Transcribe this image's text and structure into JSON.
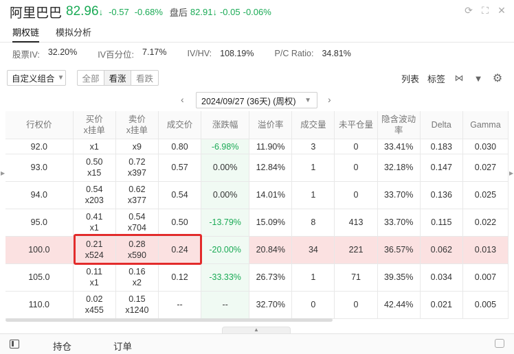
{
  "header": {
    "stock_name": "阿里巴巴",
    "price": "82.96",
    "price_arrow": "↓",
    "change": "-0.57",
    "change_pct": "-0.68%",
    "afterhours_label": "盘后",
    "afterhours_price": "82.91",
    "afterhours_arrow": "↓",
    "afterhours_change": "-0.05",
    "afterhours_change_pct": "-0.06%"
  },
  "tabs": [
    {
      "label": "期权链",
      "active": true
    },
    {
      "label": "模拟分析",
      "active": false
    }
  ],
  "stats": [
    {
      "label": "股票IV:",
      "value": "32.20%"
    },
    {
      "label": "IV百分位:",
      "value": "7.17%"
    },
    {
      "label": "IV/HV:",
      "value": "108.19%"
    },
    {
      "label": "P/C Ratio:",
      "value": "34.81%"
    }
  ],
  "toolbar": {
    "combo_label": "自定义组合",
    "filters": [
      "全部",
      "看涨",
      "看跌"
    ],
    "active_filter": "看涨",
    "list_label": "列表",
    "tag_label": "标签"
  },
  "date_selector": {
    "value": "2024/09/27 (36天) (周权)"
  },
  "table": {
    "headers": [
      "行权价",
      "买价\nx挂单",
      "卖价\nx挂单",
      "成交价",
      "涨跌幅",
      "溢价率",
      "成交量",
      "未平仓量",
      "隐含波动率",
      "Delta",
      "Gamma"
    ],
    "rows": [
      {
        "strike": "92.0",
        "bid": "",
        "bid_size": "x1",
        "ask": "",
        "ask_size": "x9",
        "last": "0.80",
        "change": "-6.98%",
        "premium": "11.90%",
        "volume": "3",
        "oi": "0",
        "iv": "33.41%",
        "delta": "0.183",
        "gamma": "0.030"
      },
      {
        "strike": "93.0",
        "bid": "0.50",
        "bid_size": "x15",
        "ask": "0.72",
        "ask_size": "x397",
        "last": "0.57",
        "change": "0.00%",
        "premium": "12.84%",
        "volume": "1",
        "oi": "0",
        "iv": "32.18%",
        "delta": "0.147",
        "gamma": "0.027"
      },
      {
        "strike": "94.0",
        "bid": "0.54",
        "bid_size": "x203",
        "ask": "0.62",
        "ask_size": "x377",
        "last": "0.54",
        "change": "0.00%",
        "premium": "14.01%",
        "volume": "1",
        "oi": "0",
        "iv": "33.70%",
        "delta": "0.136",
        "gamma": "0.025"
      },
      {
        "strike": "95.0",
        "bid": "0.41",
        "bid_size": "x1",
        "ask": "0.54",
        "ask_size": "x704",
        "last": "0.50",
        "change": "-13.79%",
        "premium": "15.09%",
        "volume": "8",
        "oi": "413",
        "iv": "33.70%",
        "delta": "0.115",
        "gamma": "0.022"
      },
      {
        "strike": "100.0",
        "bid": "0.21",
        "bid_size": "x524",
        "ask": "0.28",
        "ask_size": "x590",
        "last": "0.24",
        "change": "-20.00%",
        "premium": "20.84%",
        "volume": "34",
        "oi": "221",
        "iv": "36.57%",
        "delta": "0.062",
        "gamma": "0.013"
      },
      {
        "strike": "105.0",
        "bid": "0.11",
        "bid_size": "x1",
        "ask": "0.16",
        "ask_size": "x2",
        "last": "0.12",
        "change": "-33.33%",
        "premium": "26.73%",
        "volume": "1",
        "oi": "71",
        "iv": "39.35%",
        "delta": "0.034",
        "gamma": "0.007"
      },
      {
        "strike": "110.0",
        "bid": "0.02",
        "bid_size": "x455",
        "ask": "0.15",
        "ask_size": "x1240",
        "last": "--",
        "change": "--",
        "premium": "32.70%",
        "volume": "0",
        "oi": "0",
        "iv": "42.44%",
        "delta": "0.021",
        "gamma": "0.005"
      }
    ]
  },
  "bottom_bar": {
    "positions_label": "持仓",
    "orders_label": "订单"
  },
  "colors": {
    "down_green": "#1aaa55",
    "highlight_row": "#fbe1e1",
    "annotation_red": "#e32b2b"
  }
}
